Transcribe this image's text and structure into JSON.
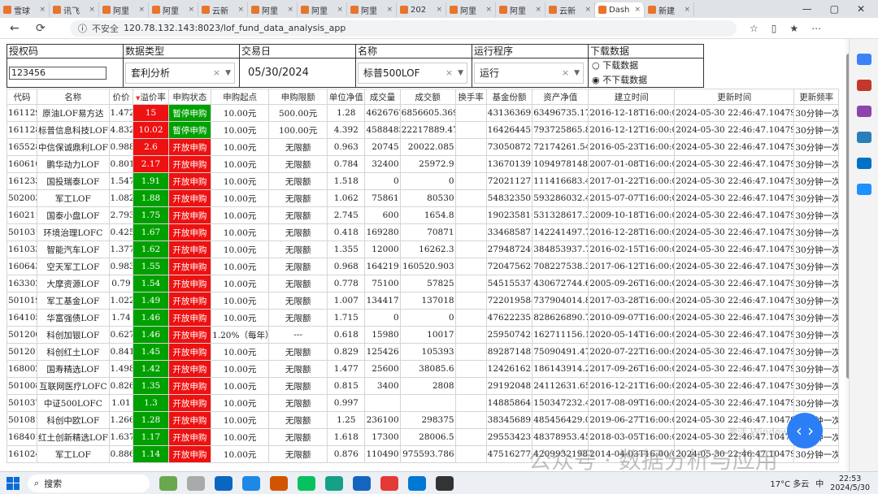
{
  "browser": {
    "tabs": [
      "雪球",
      "讯飞",
      "阿里",
      "阿里",
      "云新",
      "阿里",
      "阿里",
      "阿里",
      "202",
      "阿里",
      "阿里",
      "云新",
      "Dash",
      "新建"
    ],
    "url_insecure": "不安全",
    "url": "120.78.132.143:8023/lof_fund_data_analysis_app"
  },
  "filters": {
    "auth_label": "授权码",
    "auth_value": "123456",
    "type_label": "数据类型",
    "type_value": "套利分析",
    "date_label": "交易日",
    "date_value": "05/30/2024",
    "name_label": "名称",
    "name_value": "标普500LOF",
    "proc_label": "运行程序",
    "proc_value": "运行",
    "dl_label": "下载数据",
    "dl_opt1": "下载数据",
    "dl_opt2": "不下载数据"
  },
  "headers": [
    "代码",
    "名称",
    "价价",
    "溢价率",
    "申购状态",
    "申购起点",
    "申购限额",
    "单位净值",
    "成交量",
    "成交额",
    "换手率",
    "基金份额",
    "资产净值",
    "建立时间",
    "更新时间",
    "更新频率"
  ],
  "rows": [
    [
      "161129",
      "原油LOF易方达",
      "1.472",
      "15",
      "暂停申购",
      "10.00元",
      "500.00元",
      "1.28",
      "4626767",
      "6856605.369",
      "",
      "43136369",
      "63496735.17",
      "2016-12-18T16:00:00",
      "2024-05-30 22:46:47.104792",
      "30分钟一次"
    ],
    [
      "161128",
      "标普信息科技LOF",
      "4.832",
      "10.02",
      "暂停申购",
      "10.00元",
      "100.00元",
      "4.392",
      "4588485",
      "22217889.478",
      "",
      "164264459",
      "793725865.89",
      "2016-12-12T16:00:00",
      "2024-05-30 22:46:47.104792",
      "30分钟一次"
    ],
    [
      "165528",
      "中信保诚鼎利LOF",
      "0.988",
      "2.6",
      "开放申购",
      "10.00元",
      "无限额",
      "0.963",
      "20745",
      "20022.085",
      "",
      "73050872",
      "72174261.54",
      "2016-05-23T16:00:00",
      "2024-05-30 22:46:47.104792",
      "30分钟一次"
    ],
    [
      "160610",
      "鹏华动力LOF",
      "0.801",
      "2.17",
      "开放申购",
      "10.00元",
      "无限额",
      "0.784",
      "32400",
      "25972.9",
      "",
      "1367013918",
      "1094978148.32",
      "2007-01-08T16:00:00",
      "2024-05-30 22:46:47.104792",
      "30分钟一次"
    ],
    [
      "161233",
      "国投瑞泰LOF",
      "1.547",
      "1.91",
      "开放申购",
      "10.00元",
      "无限额",
      "1.518",
      "0",
      "0",
      "",
      "72021127",
      "111416683.47",
      "2017-01-22T16:00:00",
      "2024-05-30 22:46:47.104792",
      "30分钟一次"
    ],
    [
      "502003",
      "军工LOF",
      "1.082",
      "1.88",
      "开放申购",
      "10.00元",
      "无限额",
      "1.062",
      "75861",
      "80530",
      "",
      "548323505",
      "593286032.41",
      "2015-07-07T16:00:00",
      "2024-05-30 22:46:47.104792",
      "30分钟一次"
    ],
    [
      "160211",
      "国泰小盘LOF",
      "2.793",
      "1.75",
      "开放申购",
      "10.00元",
      "无限额",
      "2.745",
      "600",
      "1654.8",
      "",
      "190235810",
      "531328617.33",
      "2009-10-18T16:00:00",
      "2024-05-30 22:46:47.104792",
      "30分钟一次"
    ],
    [
      "501031",
      "环境治理LOFC",
      "0.425",
      "1.67",
      "开放申购",
      "10.00元",
      "无限额",
      "0.418",
      "169280",
      "70871",
      "",
      "334685877",
      "142241497.73",
      "2016-12-28T16:00:00",
      "2024-05-30 22:46:47.104792",
      "30分钟一次"
    ],
    [
      "161033",
      "智能汽车LOF",
      "1.377",
      "1.62",
      "开放申购",
      "10.00元",
      "无限额",
      "1.355",
      "12000",
      "16262.3",
      "",
      "279487246",
      "384853937.74",
      "2016-02-15T16:00:00",
      "2024-05-30 22:46:47.104792",
      "30分钟一次"
    ],
    [
      "160643",
      "空天军工LOF",
      "0.983",
      "1.55",
      "开放申购",
      "10.00元",
      "无限额",
      "0.968",
      "164219",
      "160520.903",
      "",
      "720475624",
      "708227538.39",
      "2017-06-12T16:00:00",
      "2024-05-30 22:46:47.104792",
      "30分钟一次"
    ],
    [
      "163302",
      "大摩资源LOF",
      "0.79",
      "1.54",
      "开放申购",
      "10.00元",
      "无限额",
      "0.778",
      "75100",
      "57825",
      "",
      "545155373",
      "430672744.67",
      "2005-09-26T16:00:00",
      "2024-05-30 22:46:47.104792",
      "30分钟一次"
    ],
    [
      "501019",
      "军工基金LOF",
      "1.022",
      "1.49",
      "开放申购",
      "10.00元",
      "无限额",
      "1.007",
      "134417",
      "137018",
      "",
      "722019584",
      "737904014.85",
      "2017-03-28T16:00:00",
      "2024-05-30 22:46:47.104792",
      "30分钟一次"
    ],
    [
      "164105",
      "华富强债LOF",
      "1.74",
      "1.46",
      "开放申购",
      "10.00元",
      "无限额",
      "1.715",
      "0",
      "0",
      "",
      "476222351",
      "828626890.74",
      "2010-09-07T16:00:00",
      "2024-05-30 22:46:47.104792",
      "30分钟一次"
    ],
    [
      "501200",
      "科创加银LOF",
      "0.627",
      "1.46",
      "开放申购",
      "1.20%（每年）",
      "---",
      "0.618",
      "15980",
      "10017",
      "",
      "259507426",
      "162711156.1",
      "2020-05-14T16:00:00",
      "2024-05-30 22:46:47.104792",
      "30分钟一次"
    ],
    [
      "501201",
      "科创红土LOF",
      "0.841",
      "1.45",
      "开放申购",
      "10.00元",
      "无限额",
      "0.829",
      "125426",
      "105393",
      "",
      "89287148",
      "75090491.47",
      "2020-07-22T16:00:00",
      "2024-05-30 22:46:47.104792",
      "30分钟一次"
    ],
    [
      "168002",
      "国寿精选LOF",
      "1.498",
      "1.42",
      "开放申购",
      "10.00元",
      "无限额",
      "1.477",
      "25600",
      "38085.6",
      "",
      "124261625",
      "186143914.25",
      "2017-09-26T16:00:00",
      "2024-05-30 22:46:47.104792",
      "30分钟一次"
    ],
    [
      "501008",
      "互联网医疗LOFC",
      "0.826",
      "1.35",
      "开放申购",
      "10.00元",
      "无限额",
      "0.815",
      "3400",
      "2808",
      "",
      "29192048",
      "24112631.65",
      "2016-12-21T16:00:00",
      "2024-05-30 22:46:47.104792",
      "30分钟一次"
    ],
    [
      "501037",
      "中证500LOFC",
      "1.01",
      "1.3",
      "开放申购",
      "10.00元",
      "无限额",
      "0.997",
      "",
      "",
      "",
      "148858646",
      "150347232.46",
      "2017-08-09T16:00:00",
      "2024-05-30 22:46:47.104792",
      "30分钟一次"
    ],
    [
      "501081",
      "科创中欧LOF",
      "1.266",
      "1.28",
      "开放申购",
      "10.00元",
      "无限额",
      "1.25",
      "236100",
      "298375",
      "",
      "383456895",
      "485456429.07",
      "2019-06-27T16:00:00",
      "2024-05-30 22:46:47.104792",
      "30分钟一次"
    ],
    [
      "168401",
      "红土创新精选LOF",
      "1.637",
      "1.17",
      "开放申购",
      "10.00元",
      "无限额",
      "1.618",
      "17300",
      "28006.5",
      "",
      "29553423",
      "48378953.45",
      "2018-03-05T16:00:00",
      "2024-05-30 22:46:47.104792",
      "30分钟一次"
    ],
    [
      "161024",
      "军工LOF",
      "0.886",
      "1.14",
      "开放申购",
      "10.00元",
      "无限额",
      "0.876",
      "1104901",
      "975593.786",
      "",
      "4751627763",
      "4209932198.02",
      "2014-04-03T16:00:00",
      "2024-05-30 22:46:47.104792",
      "30分钟一次"
    ]
  ],
  "hot_threshold": 2,
  "colors": {
    "red": "#ee1111",
    "green": "#00a000"
  },
  "taskbar": {
    "search": "搜索",
    "weather": "17°C 多云",
    "ime": "中",
    "time": "22:53",
    "date": "2024/5/30"
  },
  "watermark": "公众号 · 数据分析与应用",
  "watermark2": "激活 Windows"
}
